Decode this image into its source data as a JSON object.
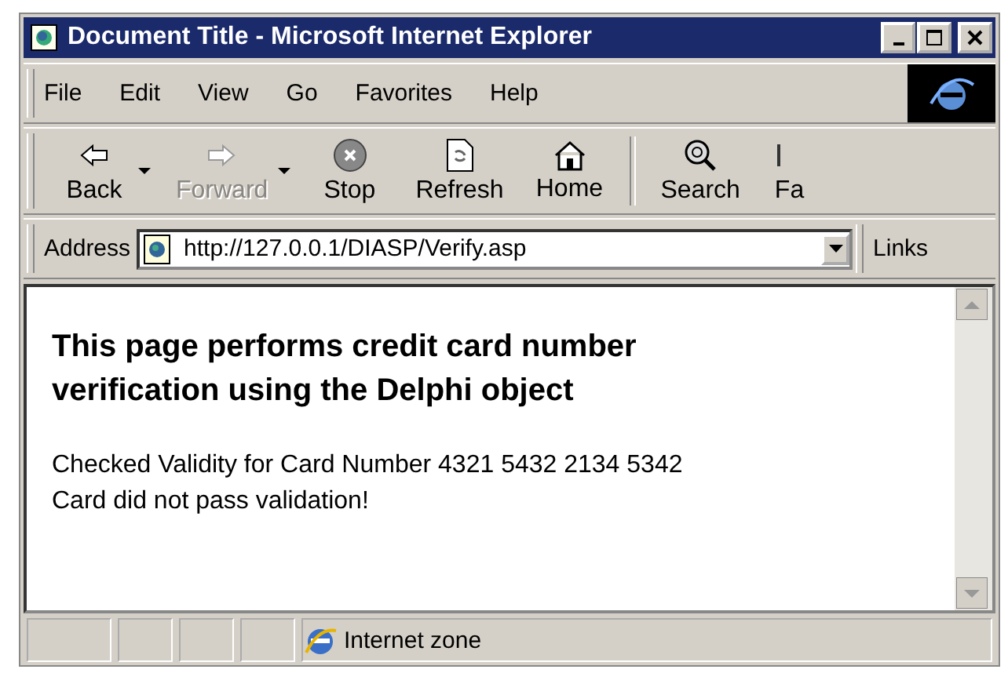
{
  "window": {
    "title": "Document Title - Microsoft Internet Explorer"
  },
  "menu": [
    "File",
    "Edit",
    "View",
    "Go",
    "Favorites",
    "Help"
  ],
  "toolbar": [
    {
      "kind": "back",
      "label": "Back",
      "disabled": false,
      "dropdown": true
    },
    {
      "kind": "forward",
      "label": "Forward",
      "disabled": true,
      "dropdown": true
    },
    {
      "kind": "stop",
      "label": "Stop",
      "disabled": false,
      "dropdown": false
    },
    {
      "kind": "refresh",
      "label": "Refresh",
      "disabled": false,
      "dropdown": false
    },
    {
      "kind": "home",
      "label": "Home",
      "disabled": false,
      "dropdown": false
    },
    {
      "kind": "search",
      "label": "Search",
      "disabled": false,
      "dropdown": false
    },
    {
      "kind": "cut",
      "label": "Fa",
      "disabled": false,
      "dropdown": false
    }
  ],
  "address": {
    "label": "Address",
    "value": "http://127.0.0.1/DIASP/Verify.asp",
    "links": "Links"
  },
  "content": {
    "heading": "This page performs credit card number verification using the Delphi object",
    "lines": [
      "Checked Validity for Card Number 4321 5432 2134 5342",
      "Card did not pass validation!"
    ]
  },
  "status_bar": {
    "zone": "Internet zone"
  }
}
